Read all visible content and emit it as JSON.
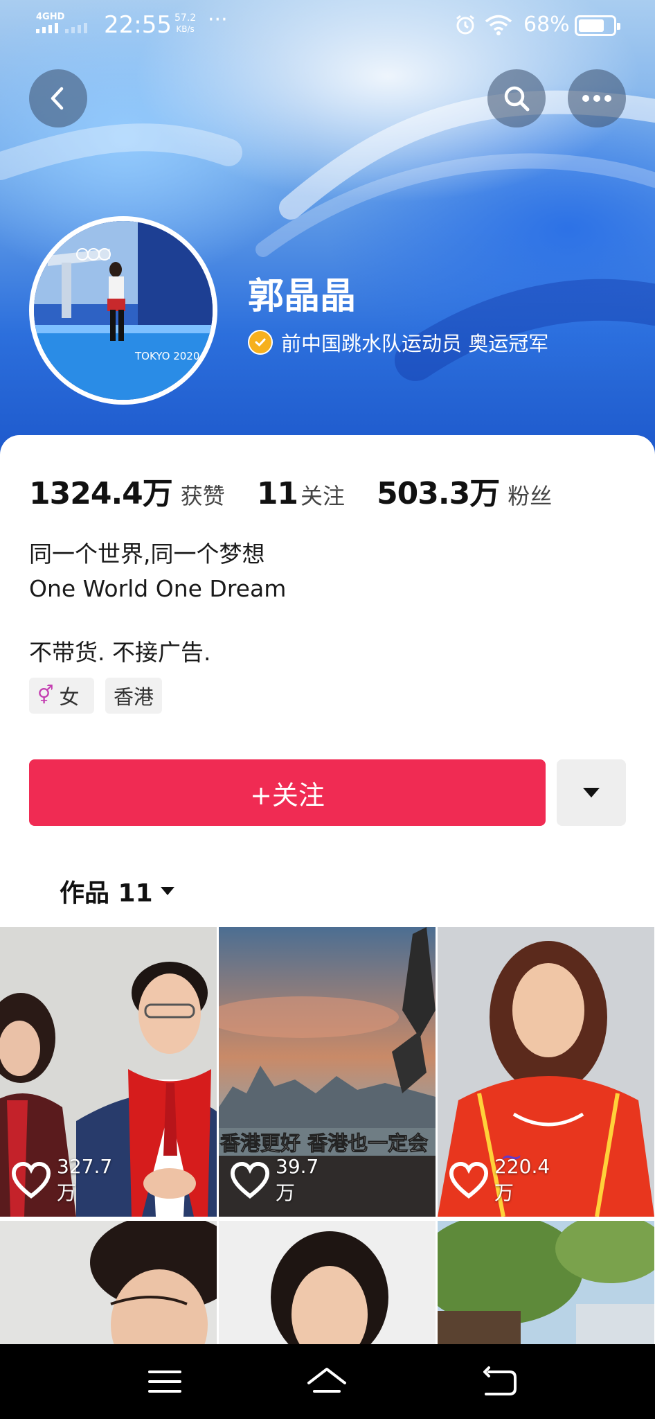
{
  "status_bar": {
    "network": "4GHD",
    "time": "22:55",
    "speed_value": "57.2",
    "speed_unit": "KB/s",
    "more": "···",
    "battery_pct": "68%"
  },
  "profile": {
    "name": "郭晶晶",
    "verified_text": "前中国跳水队运动员 奥运冠军",
    "avatar_sign": "TOKYO 2020"
  },
  "stats": [
    {
      "value": "1324.4万",
      "label": "获赞"
    },
    {
      "value": "11",
      "label": "关注"
    },
    {
      "value": "503.3万",
      "label": "粉丝"
    }
  ],
  "bio": {
    "line1": "同一个世界,同一个梦想",
    "line2": "One World One Dream",
    "line3": "不带货. 不接广告."
  },
  "tags": {
    "gender_symbol": "⚥",
    "gender": "女",
    "city": "香港"
  },
  "actions": {
    "follow": "+关注"
  },
  "works_tab": {
    "label": "作品 11"
  },
  "videos": [
    {
      "likes": "327.7万"
    },
    {
      "likes": "39.7万",
      "caption": "香港更好  香港也一定会"
    },
    {
      "likes": "220.4万"
    }
  ],
  "colors": {
    "accent": "#f02b53",
    "verify_badge": "#f6b01e",
    "banner": "#2c6fdc"
  }
}
